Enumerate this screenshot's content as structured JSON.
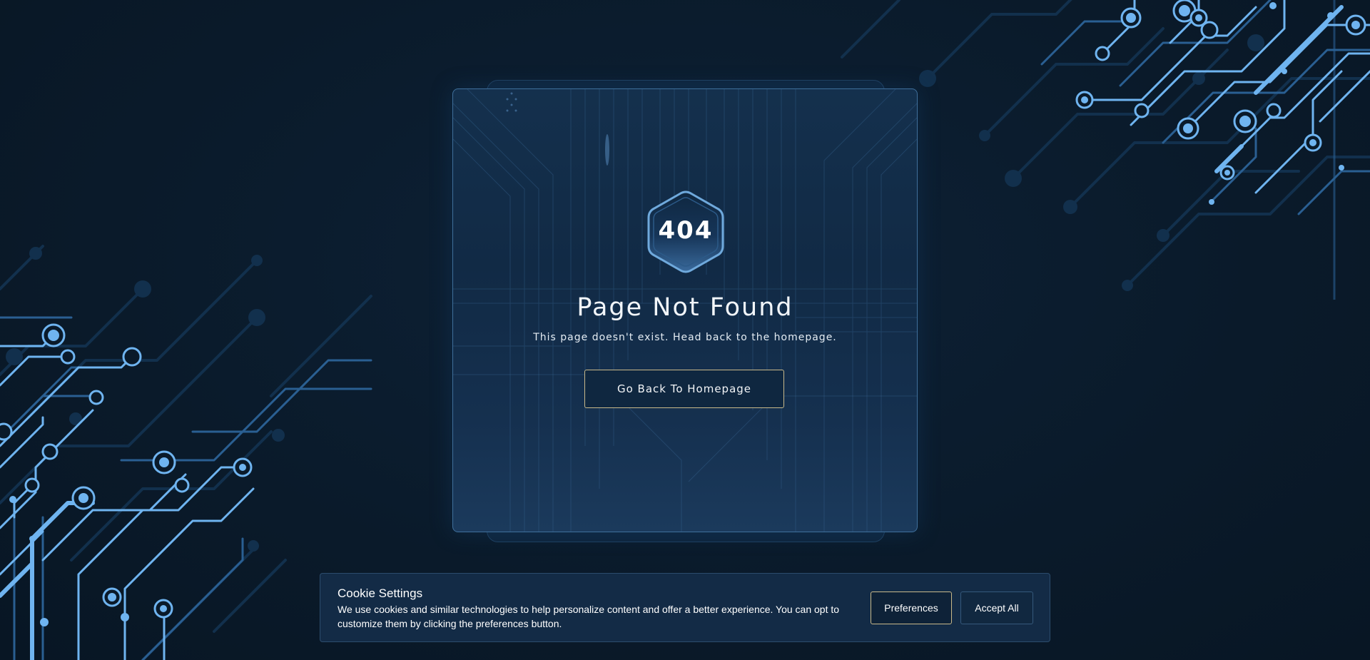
{
  "error": {
    "code": "404",
    "title": "Page Not Found",
    "message": "This page doesn't exist. Head back to the homepage.",
    "button_label": "Go Back To Homepage"
  },
  "cookie_banner": {
    "title": "Cookie Settings",
    "text": "We use cookies and similar technologies to help personalize content and offer a better experience. You can opt to customize them by clicking the preferences button.",
    "preferences_label": "Preferences",
    "accept_label": "Accept All"
  },
  "colors": {
    "background": "#0a1a2a",
    "card": "#14304d",
    "accent_blue": "#6fb4f0",
    "button_border_gold": "#c9b98a"
  },
  "icons": {
    "badge": "hexagon-badge-icon",
    "decoration": "circuit-board-decoration"
  }
}
